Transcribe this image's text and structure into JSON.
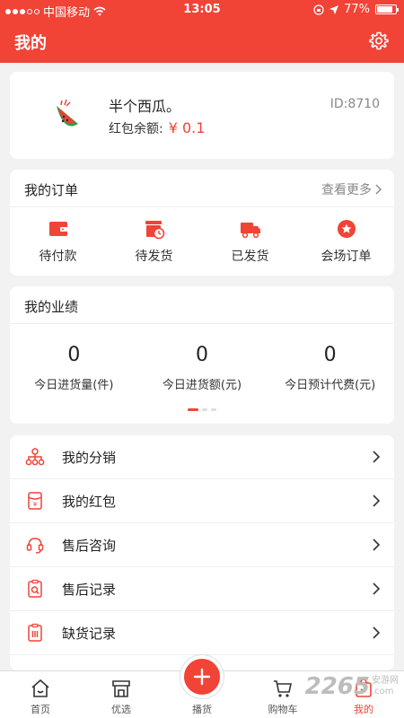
{
  "status_bar": {
    "carrier": "中国移动",
    "time": "13:05",
    "battery": "77%"
  },
  "header": {
    "title": "我的",
    "settings_icon": "gear-icon"
  },
  "profile": {
    "avatar_icon": "watermelon-icon",
    "username": "半个西瓜。",
    "balance_label": "红包余额:",
    "balance_value": "¥ 0.1",
    "user_id": "ID:8710"
  },
  "orders": {
    "title": "我的订单",
    "more_label": "查看更多",
    "items": [
      {
        "label": "待付款",
        "icon": "wallet-icon"
      },
      {
        "label": "待发货",
        "icon": "clock-box-icon"
      },
      {
        "label": "已发货",
        "icon": "truck-icon"
      },
      {
        "label": "会场订单",
        "icon": "star-badge-icon"
      }
    ]
  },
  "performance": {
    "title": "我的业绩",
    "items": [
      {
        "value": "0",
        "label": "今日进货量(件)"
      },
      {
        "value": "0",
        "label": "今日进货额(元)"
      },
      {
        "value": "0",
        "label": "今日预计代费(元)"
      }
    ],
    "page_count": 3,
    "active_page": 1
  },
  "menu": {
    "items": [
      {
        "label": "我的分销",
        "icon": "distribution-icon"
      },
      {
        "label": "我的红包",
        "icon": "red-packet-icon"
      },
      {
        "label": "售后咨询",
        "icon": "headset-icon"
      },
      {
        "label": "售后记录",
        "icon": "clipboard-search-icon"
      },
      {
        "label": "缺货记录",
        "icon": "clipboard-list-icon"
      }
    ]
  },
  "tab_bar": {
    "items": [
      {
        "label": "首页",
        "icon": "home-icon"
      },
      {
        "label": "优选",
        "icon": "store-icon"
      },
      {
        "label": "播货",
        "icon": "plus-icon"
      },
      {
        "label": "购物车",
        "icon": "cart-icon"
      },
      {
        "label": "我的",
        "icon": "user-bag-icon"
      }
    ],
    "active_index": 4
  },
  "watermark": {
    "number": "2265",
    "suffix_top": "安游网",
    "suffix_bottom": ".com"
  },
  "colors": {
    "brand": "#f14336",
    "background": "#f2f2f2"
  }
}
